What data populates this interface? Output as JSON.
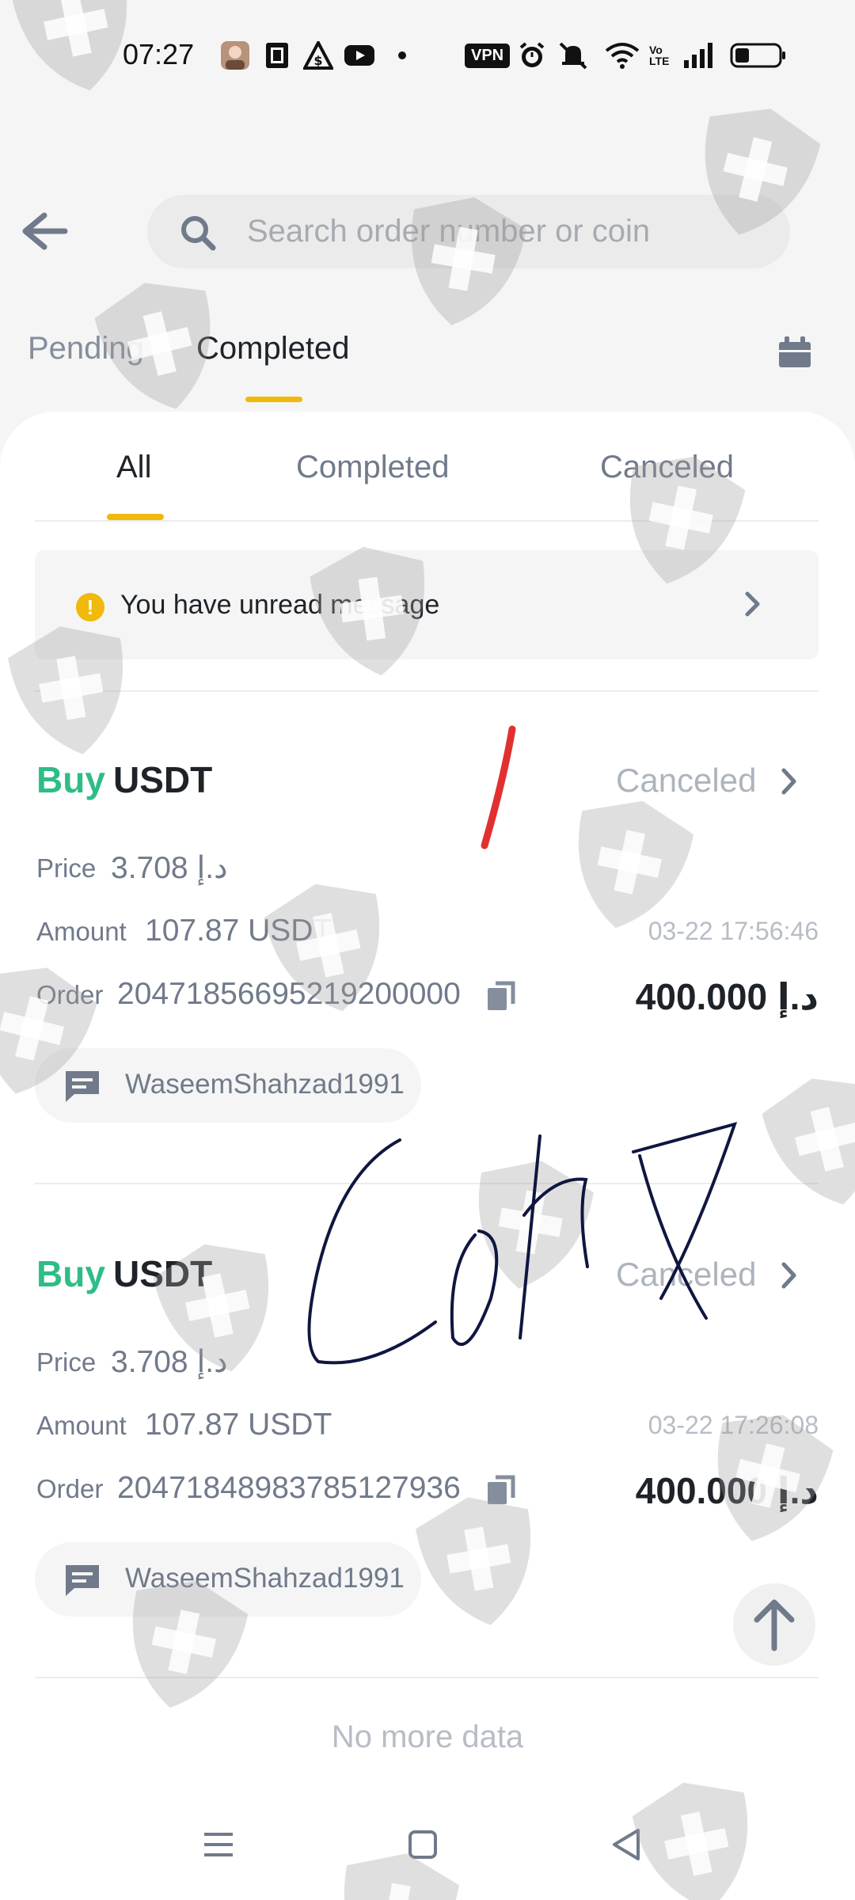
{
  "status_bar": {
    "time": "07:27",
    "icons": [
      "avatar-icon",
      "sim-icon",
      "dollar-gear-icon",
      "youtube-icon",
      "dot-icon",
      "alarm-icon",
      "bell-muted-icon",
      "wifi-icon",
      "signal-icon",
      "battery-icon"
    ],
    "vpn": "VPN",
    "volte": "Vo\nLTE"
  },
  "header": {
    "search_placeholder": "Search order number or coin",
    "tabs": [
      "Pending",
      "Completed"
    ],
    "active_tab": "Completed"
  },
  "filters": {
    "tabs": [
      "All",
      "Completed",
      "Canceled"
    ],
    "active": "All"
  },
  "banner": {
    "text": "You have unread message"
  },
  "orders": [
    {
      "side": "Buy",
      "coin": "USDT",
      "status": "Canceled",
      "price_label": "Price",
      "price": "3.708 د.إ",
      "amount_label": "Amount",
      "amount": "107.87 USDT",
      "order_label": "Order",
      "order_number": "20471856695219200000",
      "timestamp": "03-22 17:56:46",
      "total": "400.000 د.إ",
      "counterparty": "WaseemShahzad1991"
    },
    {
      "side": "Buy",
      "coin": "USDT",
      "status": "Canceled",
      "price_label": "Price",
      "price": "3.708 د.إ",
      "amount_label": "Amount",
      "amount": "107.87 USDT",
      "order_label": "Order",
      "order_number": "20471848983785127936",
      "timestamp": "03-22 17:26:08",
      "total": "400.000 د.إ",
      "counterparty": "WaseemShahzad1991"
    }
  ],
  "footer": {
    "no_more": "No more data"
  },
  "colors": {
    "accent": "#f0b90b",
    "buy": "#2ebd85",
    "text": "#1e2329",
    "muted": "#707a8a"
  }
}
